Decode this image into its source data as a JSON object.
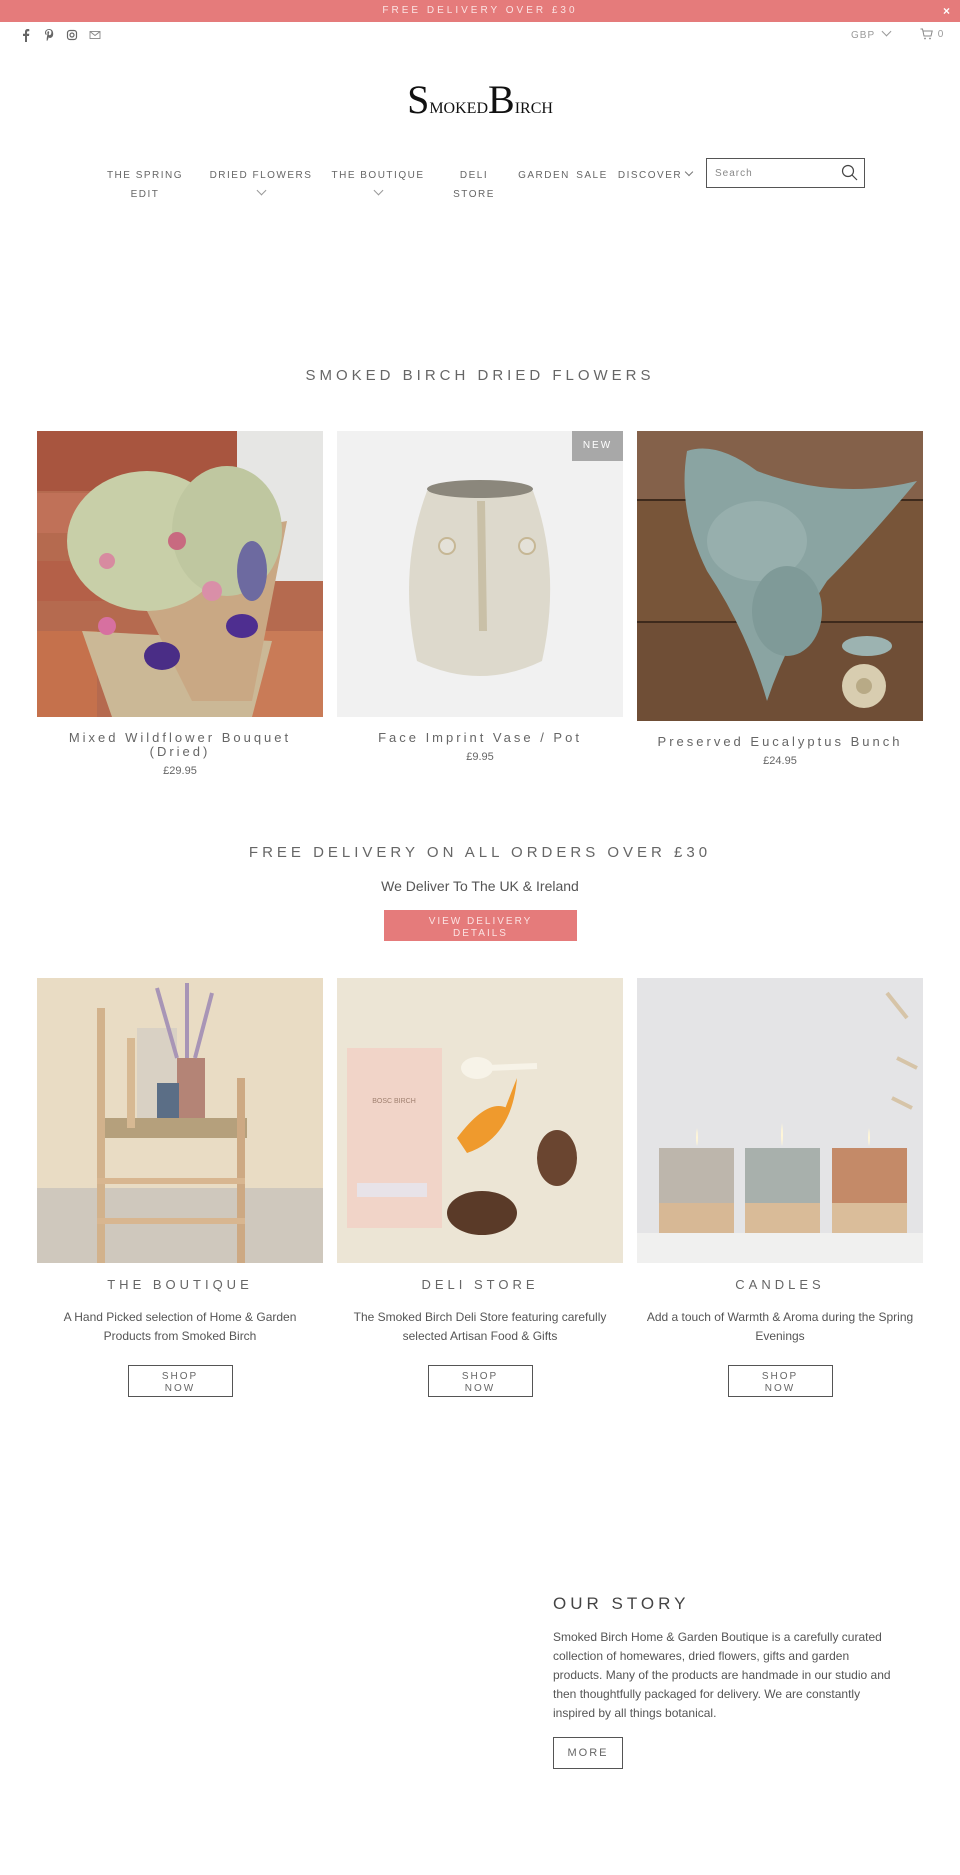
{
  "announcement": {
    "text": "FREE DELIVERY OVER £30",
    "close_label": "×",
    "bg_color": "#e57b7b"
  },
  "utility": {
    "social_icons": [
      "facebook-icon",
      "pinterest-icon",
      "instagram-icon",
      "email-icon"
    ],
    "currency": "GBP",
    "cart_count": "0"
  },
  "logo": {
    "first_initial": "S",
    "first_rest": "MOKED",
    "second_initial": "B",
    "second_rest": "IRCH"
  },
  "nav": {
    "items": [
      {
        "line1": "THE SPRING",
        "line2": "EDIT"
      },
      {
        "line1": "DRIED FLOWERS",
        "dropdown": true
      },
      {
        "line1": "THE BOUTIQUE",
        "dropdown": true
      },
      {
        "line1": "DELI",
        "line2": "STORE"
      },
      {
        "line1": "GARDEN"
      },
      {
        "line1": "SALE"
      },
      {
        "line1": "DISCOVER",
        "dropdown": true
      }
    ],
    "search_placeholder": "Search"
  },
  "featured": {
    "title": "SMOKED BIRCH DRIED FLOWERS",
    "products": [
      {
        "name": "Mixed Wildflower Bouquet (Dried)",
        "price": "£29.95"
      },
      {
        "name": "Face Imprint Vase / Pot",
        "price": "£9.95",
        "badge": "NEW"
      },
      {
        "name": "Preserved Eucalyptus Bunch",
        "price": "£24.95"
      }
    ]
  },
  "delivery": {
    "title": "FREE DELIVERY ON ALL ORDERS OVER £30",
    "subtitle": "We Deliver To The UK & Ireland",
    "button_line1": "VIEW DELIVERY",
    "button_line2": "DETAILS"
  },
  "collections": [
    {
      "title": "THE BOUTIQUE",
      "description": "A Hand Picked selection of Home & Garden Products from Smoked Birch",
      "button_line1": "SHOP",
      "button_line2": "NOW"
    },
    {
      "title": "DELI STORE",
      "description": "The Smoked Birch Deli Store featuring carefully selected Artisan Food & Gifts",
      "button_line1": "SHOP",
      "button_line2": "NOW"
    },
    {
      "title": "CANDLES",
      "description": "Add a touch of Warmth & Aroma during the Spring Evenings",
      "button_line1": "SHOP",
      "button_line2": "NOW"
    }
  ],
  "story": {
    "title": "OUR STORY",
    "body": "Smoked Birch Home & Garden Boutique is a carefully curated collection of homewares, dried flowers, gifts and garden products. Many of the products are handmade in our studio and then thoughtfully packaged for delivery. We are constantly inspired by all things botanical.",
    "button": "MORE"
  }
}
